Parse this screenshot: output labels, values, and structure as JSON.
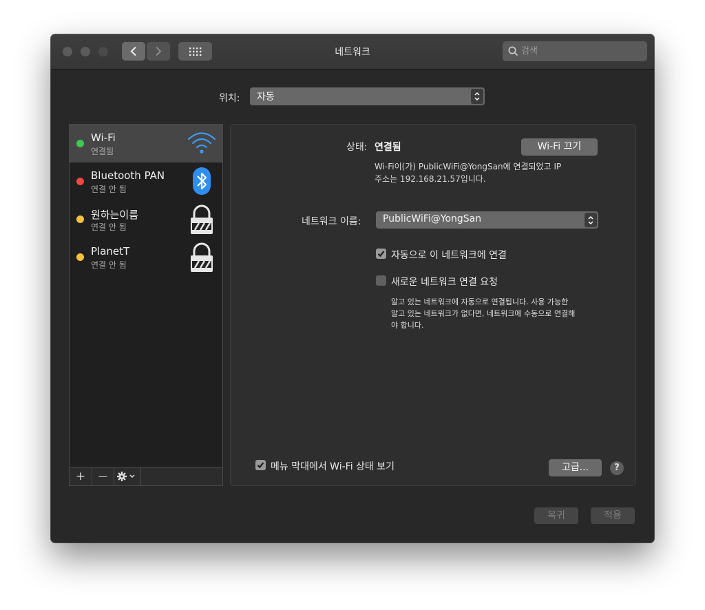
{
  "window": {
    "title": "네트워크",
    "search_placeholder": "검색"
  },
  "location": {
    "label": "위치:",
    "value": "자동"
  },
  "services": [
    {
      "name": "Wi-Fi",
      "status": "연결됨",
      "dot_color": "#3fc952",
      "icon": "wifi-icon"
    },
    {
      "name": "Bluetooth PAN",
      "status": "연결 안 됨",
      "dot_color": "#f0473e",
      "icon": "bluetooth-icon"
    },
    {
      "name": "원하는이름",
      "status": "연결 안 됨",
      "dot_color": "#f7c13a",
      "icon": "lock-icon"
    },
    {
      "name": "PlanetT",
      "status": "연결 안 됨",
      "dot_color": "#f7c13a",
      "icon": "lock-icon"
    }
  ],
  "sidebar_toolbar": {
    "add": "+",
    "remove": "—"
  },
  "detail": {
    "status_label": "상태:",
    "status_value": "연결됨",
    "wifi_off_button": "Wi-Fi 끄기",
    "status_desc_line1": "Wi-Fi이(가) PublicWiFi@YongSan에 연결되었고 IP",
    "status_desc_line2": "주소는 192.168.21.57입니다.",
    "network_name_label": "네트워크 이름:",
    "network_name_value": "PublicWiFi@YongSan",
    "auto_join_label": "자동으로 이 네트워크에 연결",
    "auto_join_checked": true,
    "ask_join_label": "새로운 네트워크 연결 요청",
    "ask_join_checked": false,
    "ask_join_desc_line1": "알고 있는 네트워크에 자동으로 연결됩니다. 사용 가능한",
    "ask_join_desc_line2": "알고 있는 네트워크가 없다면, 네트워크에 수동으로 연결해",
    "ask_join_desc_line3": "야 합니다.",
    "menu_bar_label": "메뉴 막대에서 Wi-Fi 상태 보기",
    "menu_bar_checked": true,
    "advanced_button": "고급...",
    "help": "?"
  },
  "footer": {
    "revert": "복귀",
    "apply": "적용"
  },
  "colors": {
    "accent_blue": "#3d9bf5",
    "window_bg": "#282828"
  }
}
